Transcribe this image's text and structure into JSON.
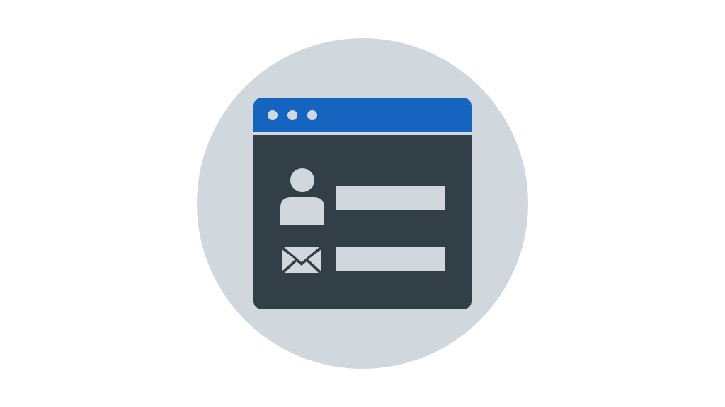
{
  "illustration": {
    "icons": [
      "user-icon",
      "mail-icon"
    ],
    "colors": {
      "background": "#ffffff",
      "circle": "#d1d8dd",
      "window_body": "#333f47",
      "titlebar": "#1565c0",
      "separator": "#d1d8dd",
      "dots": "#d1d8dd",
      "fields": "#d1d8dd",
      "icons": "#d1d8dd"
    }
  }
}
